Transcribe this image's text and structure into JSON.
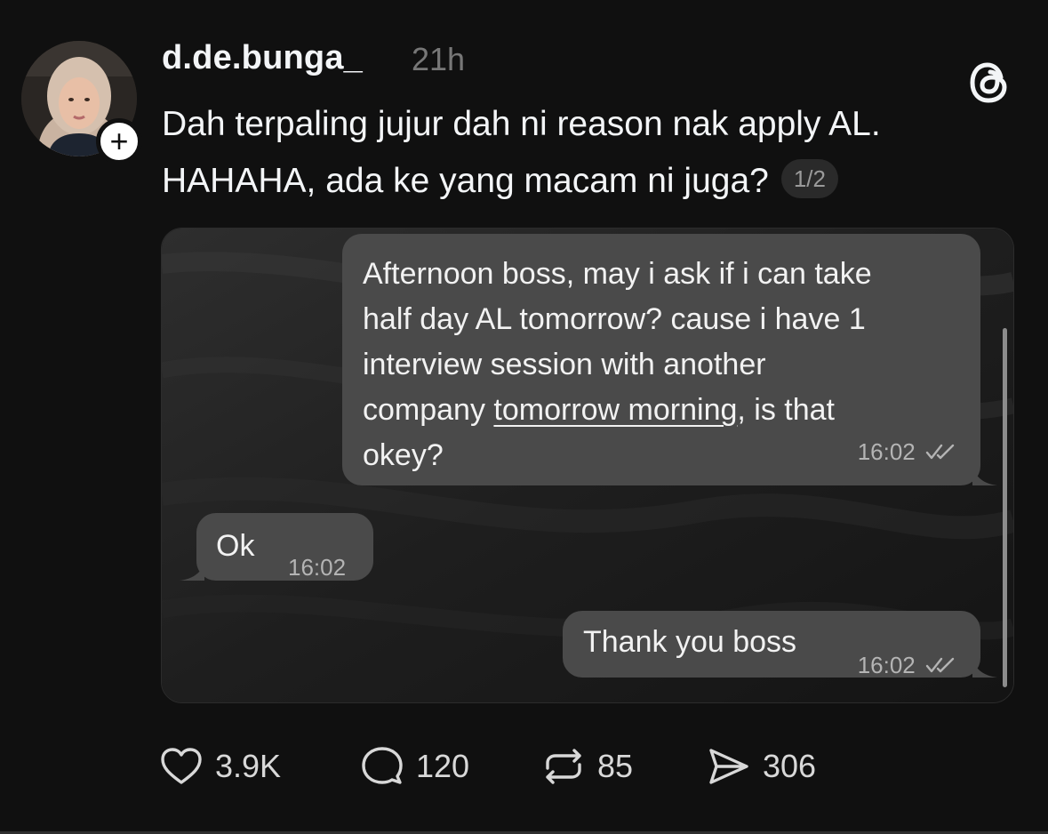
{
  "post": {
    "username": "d.de.bunga_",
    "time": "21h",
    "caption_line1": "Dah terpaling jujur dah ni reason nak apply AL.",
    "caption_line2": "HAHAHA, ada ke yang macam ni juga?",
    "page_indicator": "1/2",
    "follow_symbol": "+"
  },
  "chat": {
    "message1": {
      "lines": [
        "Afternoon boss, may i ask if i can take",
        "half day AL tomorrow? cause i have 1",
        "interview session with another"
      ],
      "line4_prefix": "company ",
      "line4_link": "tomorrow morning",
      "line4_suffix": ", is that",
      "line5": "okey?",
      "time": "16:02",
      "status": "read"
    },
    "message2": {
      "text": "Ok",
      "time": "16:02"
    },
    "message3": {
      "text": "Thank you boss",
      "time": "16:02",
      "status": "read"
    }
  },
  "actions": {
    "likes": "3.9K",
    "replies": "120",
    "reposts": "85",
    "shares": "306"
  },
  "icons": {
    "logo": "threads-logo-icon",
    "like": "heart-icon",
    "reply": "comment-bubble-icon",
    "repost": "repost-icon",
    "share": "send-icon",
    "read_receipt": "double-check-icon"
  },
  "colors": {
    "background": "#101010",
    "text": "#f3f5f7",
    "muted": "#777777",
    "bubble": "#4a4a4a"
  }
}
